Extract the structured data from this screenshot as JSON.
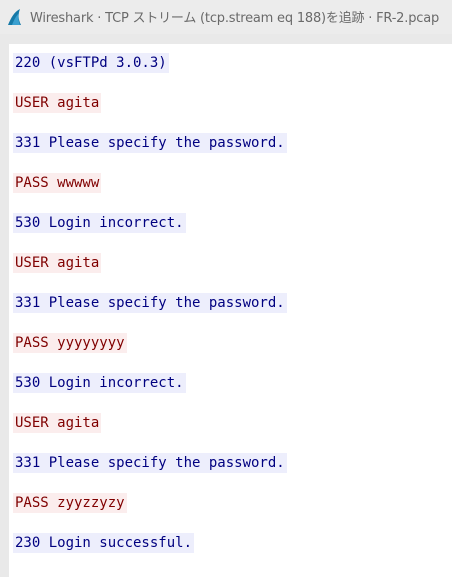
{
  "window": {
    "title": "Wireshark · TCP ストリーム (tcp.stream eq 188)を追跡 · FR-2.pcap"
  },
  "icons": {
    "app": "wireshark-fin-icon"
  },
  "colors": {
    "server_text": "#000080",
    "server_bg": "#edeefc",
    "client_text": "#800000",
    "client_bg": "#fbeded"
  },
  "stream": {
    "lines": [
      {
        "text": "220 (vsFTPd 3.0.3)",
        "direction": "server"
      },
      {
        "text": "USER agita",
        "direction": "client"
      },
      {
        "text": "331 Please specify the password.",
        "direction": "server"
      },
      {
        "text": "PASS wwwww",
        "direction": "client"
      },
      {
        "text": "530 Login incorrect.",
        "direction": "server"
      },
      {
        "text": "USER agita",
        "direction": "client"
      },
      {
        "text": "331 Please specify the password.",
        "direction": "server"
      },
      {
        "text": "PASS yyyyyyyy",
        "direction": "client"
      },
      {
        "text": "530 Login incorrect.",
        "direction": "server"
      },
      {
        "text": "USER agita",
        "direction": "client"
      },
      {
        "text": "331 Please specify the password.",
        "direction": "server"
      },
      {
        "text": "PASS zyyzzyzy",
        "direction": "client"
      },
      {
        "text": "230 Login successful.",
        "direction": "server"
      }
    ]
  }
}
